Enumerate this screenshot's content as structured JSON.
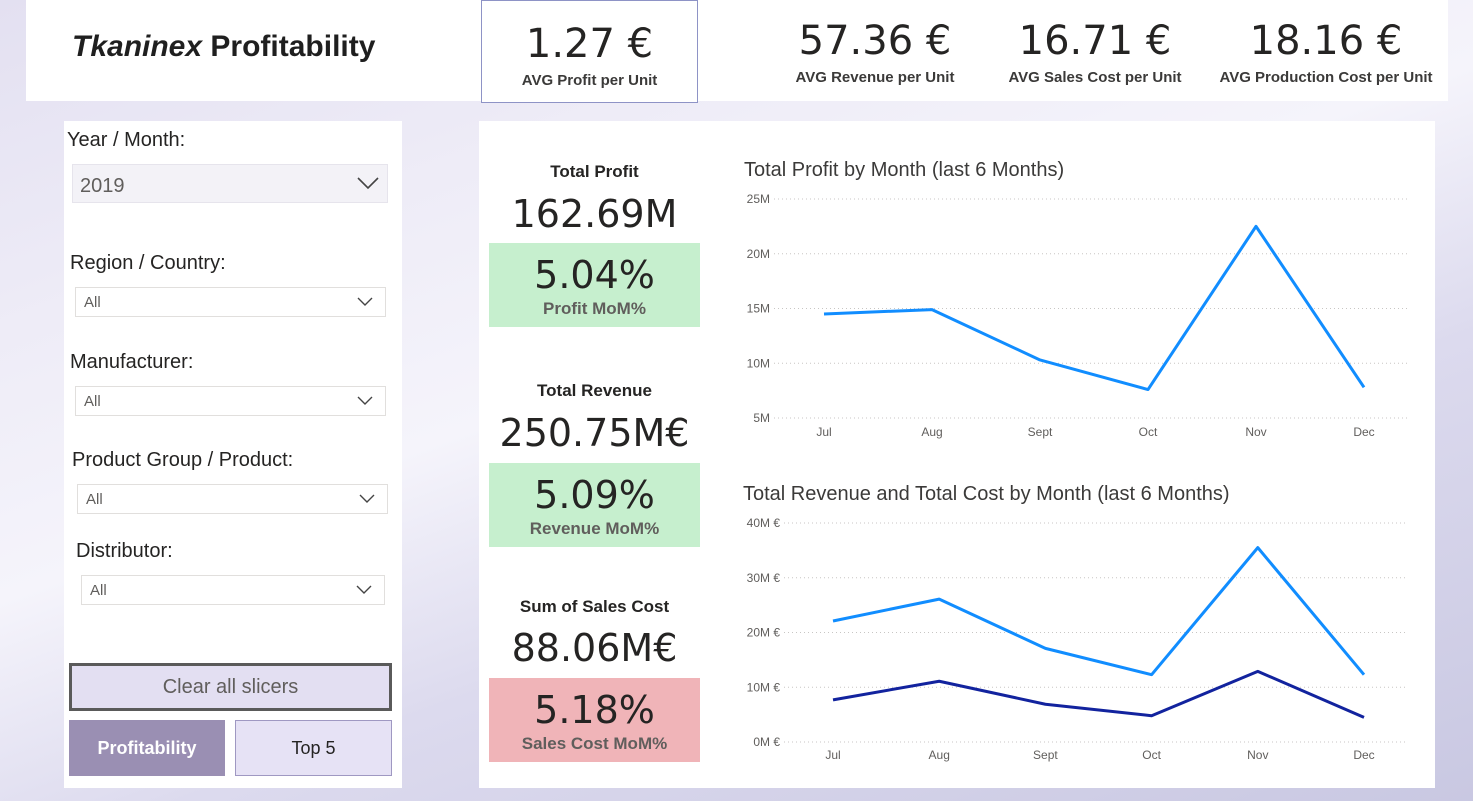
{
  "header": {
    "title_brand": "Tkaninex",
    "title_rest": " Profitability",
    "kpis": [
      {
        "value": "1.27 €",
        "label": "AVG Profit per Unit"
      },
      {
        "value": "57.36 €",
        "label": "AVG Revenue per Unit"
      },
      {
        "value": "16.71 €",
        "label": "AVG Sales Cost per Unit"
      },
      {
        "value": "18.16 €",
        "label": "AVG Production Cost per Unit"
      }
    ]
  },
  "slicers": {
    "year": {
      "label": "Year / Month:",
      "value": "2019"
    },
    "region": {
      "label": "Region / Country:",
      "value": "All"
    },
    "manufacturer": {
      "label": "Manufacturer:",
      "value": "All"
    },
    "product": {
      "label": "Product Group / Product:",
      "value": "All"
    },
    "distributor": {
      "label": "Distributor:",
      "value": "All"
    },
    "clear_label": "Clear all slicers"
  },
  "nav": {
    "profitability": "Profitability",
    "top5": "Top 5"
  },
  "cards": [
    {
      "title": "Total Profit",
      "value": "162.69M",
      "mom_value": "5.04%",
      "mom_label": "Profit MoM%"
    },
    {
      "title": "Total Revenue",
      "value": "250.75M€",
      "mom_value": "5.09%",
      "mom_label": "Revenue MoM%"
    },
    {
      "title": "Sum of Sales Cost",
      "value": "88.06M€",
      "mom_value": "5.18%",
      "mom_label": "Sales Cost MoM%"
    }
  ],
  "colors": {
    "series_primary": "#118dff",
    "series_secondary": "#12239e",
    "mom_positive": "#c6efce",
    "mom_negative": "#f0b4b8",
    "nav_active": "#9a8fb3"
  },
  "chart_data": [
    {
      "type": "line",
      "title": "Total Profit by Month (last 6 Months)",
      "x": [
        "Jul",
        "Aug",
        "Sept",
        "Oct",
        "Nov",
        "Dec"
      ],
      "y_ticks": [
        "5M",
        "10M",
        "15M",
        "20M",
        "25M"
      ],
      "ylim": [
        5,
        25
      ],
      "grid": true,
      "series": [
        {
          "values": [
            14.5,
            14.9,
            10.3,
            7.6,
            22.5,
            7.8
          ]
        }
      ]
    },
    {
      "type": "line",
      "title": "Total Revenue and Total Cost by Month (last 6 Months)",
      "x": [
        "Jul",
        "Aug",
        "Sept",
        "Oct",
        "Nov",
        "Dec"
      ],
      "y_ticks": [
        "0M €",
        "10M €",
        "20M €",
        "30M €",
        "40M €"
      ],
      "ylim": [
        0,
        40
      ],
      "grid": true,
      "series": [
        {
          "values": [
            22.1,
            26.1,
            17.1,
            12.3,
            35.5,
            12.3
          ]
        },
        {
          "values": [
            7.7,
            11.1,
            6.9,
            4.8,
            12.9,
            4.5
          ]
        }
      ]
    }
  ]
}
